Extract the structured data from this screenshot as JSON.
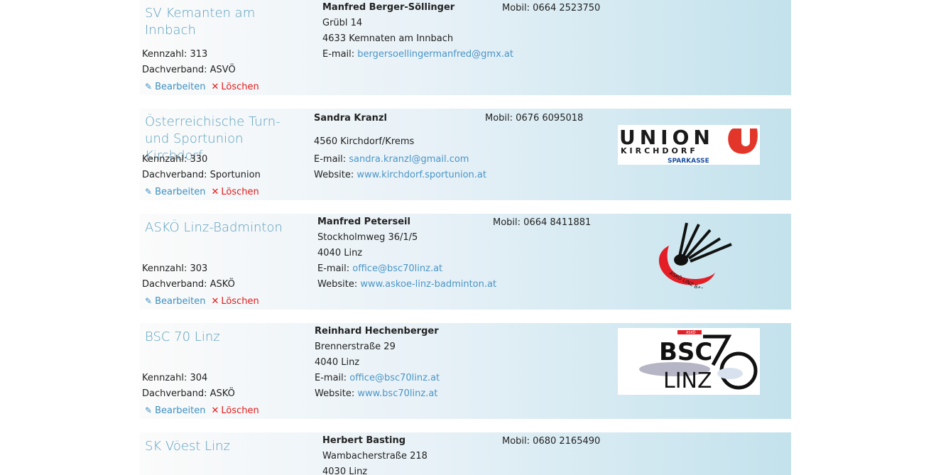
{
  "labels": {
    "kennzahl": "Kennzahl:",
    "dachverband": "Dachverband:",
    "email": "E-mail:",
    "website": "Website:",
    "mobil": "Mobil:",
    "edit": "Bearbeiten",
    "delete": "Löschen"
  },
  "icons": {
    "edit": "pencil-icon",
    "delete": "close-icon"
  },
  "colors": {
    "link": "#4a95c8",
    "title": "#5a9fbe",
    "delete": "#e21b1b"
  },
  "clubs": [
    {
      "name": "SV Kemanten am Innbach",
      "kennzahl": "313",
      "dachverband": "ASVÖ",
      "contact_name": "Manfred Berger-Söllinger",
      "street": "Grübl 14",
      "city": "4633 Kemnaten am Innbach",
      "email": "bergersoellingermanfred@gmx.at",
      "mobil": "0664 2523750"
    },
    {
      "name": "Österreichische Turn- und Sportunion Kirchdorf",
      "kennzahl": "330",
      "dachverband": "Sportunion",
      "contact_name": "Sandra Kranzl",
      "city": "4560 Kirchdorf/Krems",
      "email": "sandra.kranzl@gmail.com",
      "website": "www.kirchdorf.sportunion.at",
      "mobil": "0676 6095018",
      "logo": {
        "line1": "UNION",
        "line2": "KIRCHDORF",
        "line3": "SPARKASSE"
      }
    },
    {
      "name": "ASKÖ Linz-Badminton",
      "kennzahl": "303",
      "dachverband": "ASKÖ",
      "contact_name": "Manfred Peterseil",
      "street": "Stockholmweg 36/1/5",
      "city": "4040 Linz",
      "email": "office@bsc70linz.at",
      "website": "www.askoe-linz-badminton.at",
      "mobil": "0664 8411881",
      "logo": {
        "arc_text": "ASKÖ LINZ BADMINTON"
      }
    },
    {
      "name": "BSC 70 Linz",
      "kennzahl": "304",
      "dachverband": "ASKÖ",
      "contact_name": "Reinhard Hechenberger",
      "street": "Brennerstraße 29",
      "city": "4040 Linz",
      "email": "office@bsc70linz.at",
      "website": "www.bsc70linz.at",
      "logo": {
        "line1": "BSC",
        "line2": "LINZ",
        "num": "70",
        "tag": "ASKÖ"
      }
    },
    {
      "name": "SK Vöest Linz",
      "contact_name": "Herbert Basting",
      "street": "Wambacherstraße 218",
      "city": "4030 Linz",
      "mobil": "0680 2165490"
    }
  ]
}
